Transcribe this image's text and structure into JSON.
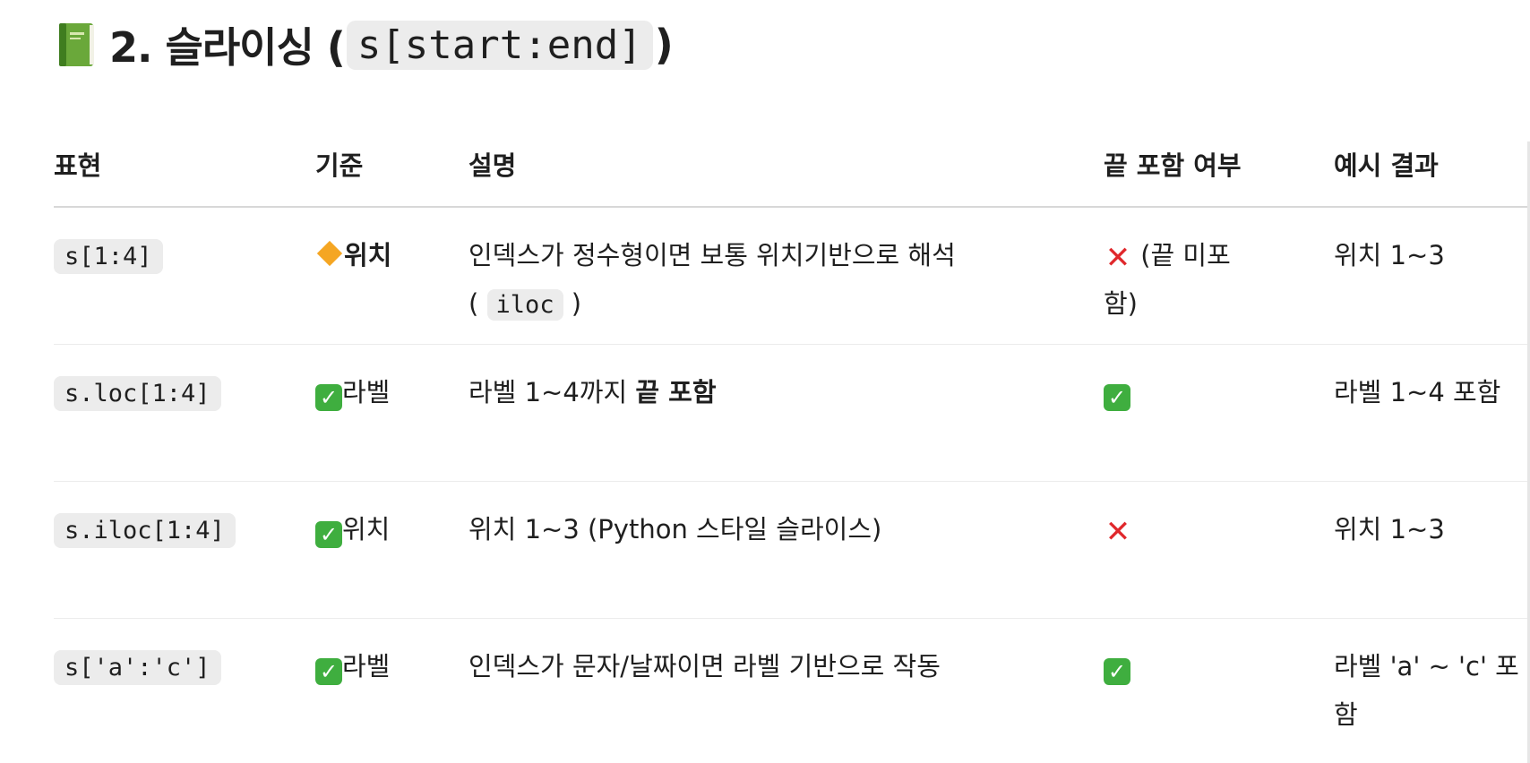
{
  "heading": {
    "prefix": "2. 슬라이싱 (",
    "code": "s[start:end]",
    "suffix": ")"
  },
  "table": {
    "headers": [
      "표현",
      "기준",
      "설명",
      "끝 포함 여부",
      "예시 결과"
    ],
    "rows": [
      {
        "expr": "s[1:4]",
        "basis": "위치",
        "desc_part1": "인덱스가 정수형이면 보통 위치기반으로 해석",
        "desc_code_open": "(",
        "desc_code": "iloc",
        "desc_code_close": ")",
        "end": "(끝 미포함)",
        "example": "위치 1~3"
      },
      {
        "expr": "s.loc[1:4]",
        "basis": "라벨",
        "desc_part1": "라벨 1~4까지 ",
        "desc_bold": "끝 포함",
        "example": "라벨 1~4 포함"
      },
      {
        "expr": "s.iloc[1:4]",
        "basis": "위치",
        "desc": "위치 1~3 (Python 스타일 슬라이스)",
        "example": "위치 1~3"
      },
      {
        "expr": "s['a':'c']",
        "basis": "라벨",
        "desc": "인덱스가 문자/날짜이면 라벨 기반으로 작동",
        "example": "라벨 'a' ~ 'c' 포함"
      }
    ]
  },
  "icons": {
    "heading": "green-book-icon",
    "basis_row0": "orange-diamond-icon",
    "basis_other": "check-mark-button-icon",
    "end_row0": "cross-mark-icon",
    "end_row1": "check-mark-button-icon",
    "end_row2": "cross-mark-icon",
    "end_row3": "check-mark-button-icon"
  },
  "colors": {
    "check": "#3fae3f",
    "cross": "#e0282c",
    "diamond": "#f5a623",
    "code_bg": "#ececec"
  }
}
